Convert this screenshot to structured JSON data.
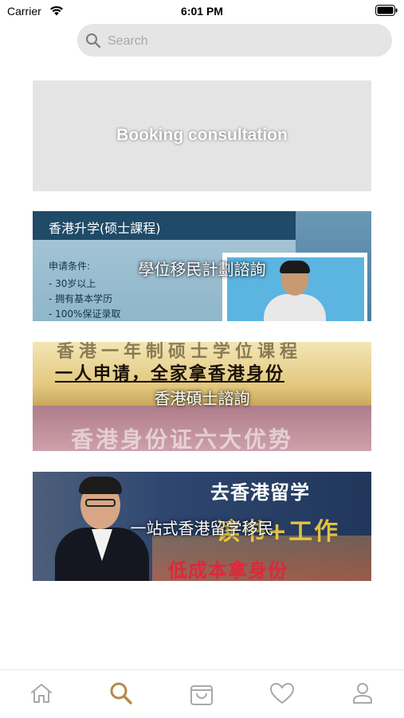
{
  "status_bar": {
    "carrier": "Carrier",
    "time": "6:01 PM"
  },
  "search": {
    "placeholder": "Search",
    "icon": "search-icon"
  },
  "cards": [
    {
      "label": "Booking consultation"
    },
    {
      "label": "學位移民計劃諮詢",
      "image_text": {
        "header": "香港升学(硕士課程)",
        "conditions": [
          "申请条件:",
          "- 30岁以上",
          "- 拥有基本学历",
          "- 100%保证录取"
        ]
      }
    },
    {
      "label": "香港碩士諮詢",
      "image_text": {
        "line1": "香港一年制硕士学位课程",
        "line2": "一人申请，全家拿香港身份",
        "line3": "香港身份证六大优势"
      }
    },
    {
      "label": "一站式香港留学移民",
      "image_text": {
        "title": "去香港留学",
        "middle": "读书+工作",
        "bottom": "低成本拿身份"
      }
    }
  ],
  "tabbar": {
    "active_tab": "search",
    "tabs": [
      {
        "name": "home",
        "icon": "home-icon"
      },
      {
        "name": "search",
        "icon": "search-icon"
      },
      {
        "name": "cart",
        "icon": "shopping-bag-icon"
      },
      {
        "name": "favorites",
        "icon": "heart-icon"
      },
      {
        "name": "profile",
        "icon": "user-icon"
      }
    ]
  },
  "colors": {
    "active_tab": "#b5894a",
    "inactive_tab": "#a9a9a9",
    "search_bg": "#e5e5e5"
  }
}
